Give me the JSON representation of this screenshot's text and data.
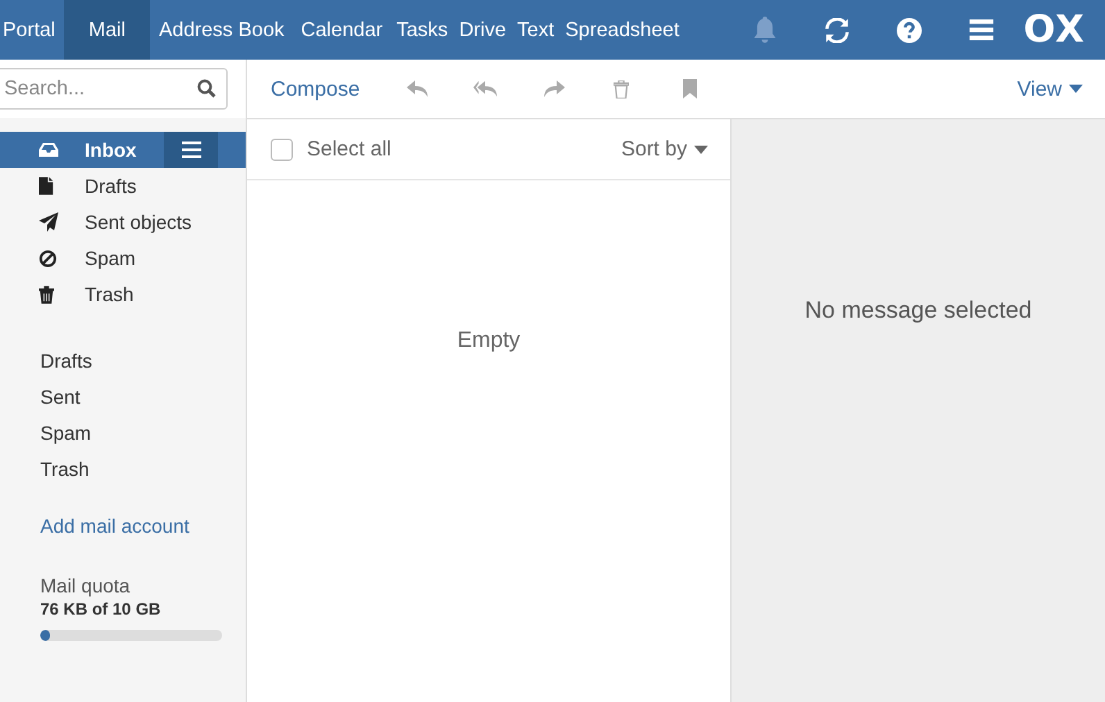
{
  "topbar": {
    "apps": [
      {
        "label": "Portal",
        "selected": false
      },
      {
        "label": "Mail",
        "selected": true
      },
      {
        "label": "Address Book",
        "selected": false
      },
      {
        "label": "Calendar",
        "selected": false
      },
      {
        "label": "Tasks",
        "selected": false
      },
      {
        "label": "Drive",
        "selected": false
      },
      {
        "label": "Text",
        "selected": false
      },
      {
        "label": "Spreadsheet",
        "selected": false
      }
    ],
    "logo": "OX"
  },
  "search": {
    "placeholder": "Search..."
  },
  "toolbar": {
    "compose": "Compose",
    "actions": [
      {
        "kind": "reply",
        "disabled": true
      },
      {
        "kind": "reply-all",
        "disabled": true
      },
      {
        "kind": "forward",
        "disabled": true
      },
      {
        "kind": "delete",
        "disabled": true
      },
      {
        "kind": "flag",
        "disabled": true
      }
    ],
    "view": "View"
  },
  "folders": [
    {
      "label": "Inbox",
      "kind": "inbox",
      "selected": true
    },
    {
      "label": "Drafts",
      "kind": "drafts",
      "selected": false
    },
    {
      "label": "Sent objects",
      "kind": "sent",
      "selected": false
    },
    {
      "label": "Spam",
      "kind": "spam",
      "selected": false
    },
    {
      "label": "Trash",
      "kind": "trash",
      "selected": false
    }
  ],
  "more_folders": [
    {
      "label": "Drafts"
    },
    {
      "label": "Sent"
    },
    {
      "label": "Spam"
    },
    {
      "label": "Trash"
    }
  ],
  "add_account": "Add mail account",
  "quota": {
    "title": "Mail quota",
    "reading": "76 KB of 10 GB",
    "level": 0.05
  },
  "list": {
    "select_all": "Select all",
    "checked": false,
    "sort": "Sort by",
    "empty": "Empty"
  },
  "detail": {
    "message": "No message selected"
  }
}
